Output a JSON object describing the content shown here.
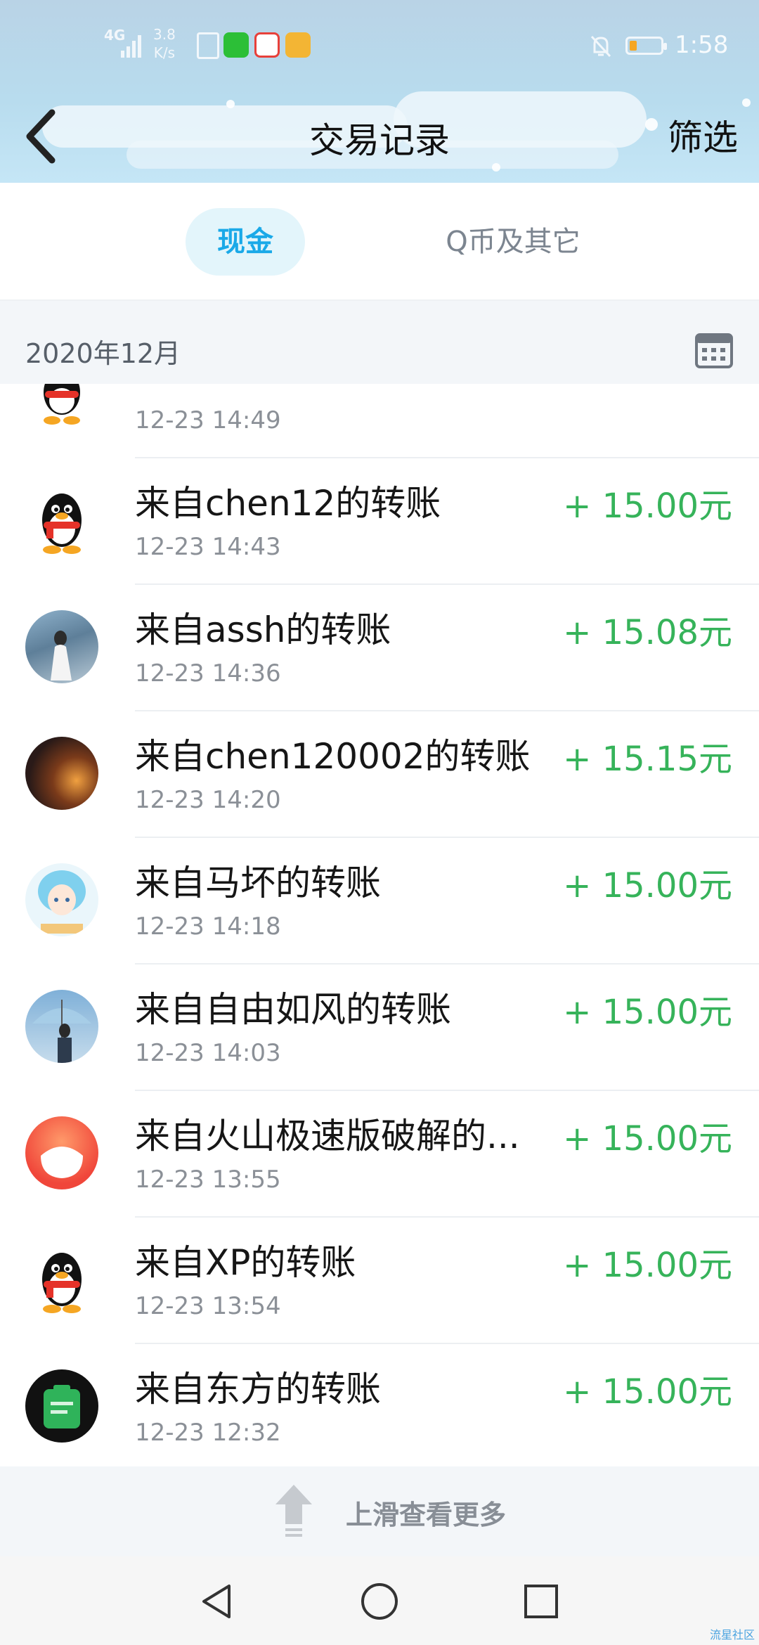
{
  "status_bar": {
    "network": "4G",
    "speed_value": "3.8",
    "speed_unit": "K/s",
    "time": "1:58"
  },
  "header": {
    "title": "交易记录",
    "filter_label": "筛选"
  },
  "tabs": [
    {
      "label": "现金",
      "active": true
    },
    {
      "label": "Q币及其它",
      "active": false
    }
  ],
  "month": {
    "label": "2020年12月"
  },
  "transactions": [
    {
      "name": "",
      "time": "12-23 14:49",
      "amount": "",
      "avatar": "qq-penguin"
    },
    {
      "name": "来自chen12的转账",
      "time": "12-23 14:43",
      "amount": "+ 15.00元",
      "avatar": "qq-penguin"
    },
    {
      "name": "来自assh的转账",
      "time": "12-23 14:36",
      "amount": "+ 15.08元",
      "avatar": "photo-sea"
    },
    {
      "name": "来自chen120002的转账",
      "time": "12-23 14:20",
      "amount": "+ 15.15元",
      "avatar": "photo-dark"
    },
    {
      "name": "来自马坏的转账",
      "time": "12-23 14:18",
      "amount": "+ 15.00元",
      "avatar": "anime-girl"
    },
    {
      "name": "来自自由如风的转账",
      "time": "12-23 14:03",
      "amount": "+ 15.00元",
      "avatar": "photo-umbrella"
    },
    {
      "name": "来自火山极速版破解的...",
      "time": "12-23 13:55",
      "amount": "+ 15.00元",
      "avatar": "volcano-app"
    },
    {
      "name": "来自XP的转账",
      "time": "12-23 13:54",
      "amount": "+ 15.00元",
      "avatar": "qq-penguin"
    },
    {
      "name": "来自东方的转账",
      "time": "12-23 12:32",
      "amount": "+ 15.00元",
      "avatar": "green-clipboard"
    }
  ],
  "load_more": {
    "label": "上滑查看更多"
  },
  "watermark": "流星社区",
  "colors": {
    "accent": "#1aa9e8",
    "amount_green": "#36b35a"
  }
}
